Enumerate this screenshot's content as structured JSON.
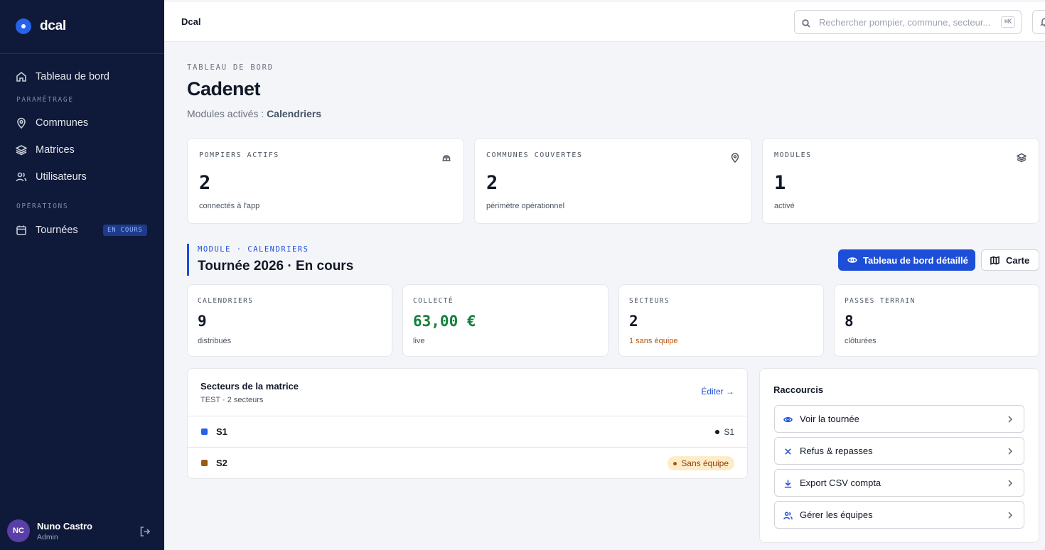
{
  "sidebar": {
    "brand": "dcal",
    "nav": {
      "dashboard": "Tableau de bord",
      "section_settings": "PARAMÉTRAGE",
      "communes": "Communes",
      "matrices": "Matrices",
      "users": "Utilisateurs",
      "section_operations": "OPÉRATIONS",
      "tours": "Tournées",
      "tours_badge": "EN COURS"
    },
    "user": {
      "initials": "NC",
      "name": "Nuno Castro",
      "role": "Admin"
    }
  },
  "topbar": {
    "title": "Dcal",
    "search_placeholder": "Rechercher pompier, commune, secteur...",
    "search_shortcut": "⌘K"
  },
  "header": {
    "eyebrow": "TABLEAU DE BORD",
    "title": "Cadenet",
    "modules_prefix": "Modules activés : ",
    "modules_value": "Calendriers"
  },
  "stats": [
    {
      "label": "POMPIERS ACTIFS",
      "value": "2",
      "sub": "connectés à l'app",
      "icon": "helmet-icon"
    },
    {
      "label": "COMMUNES COUVERTES",
      "value": "2",
      "sub": "périmètre opérationnel",
      "icon": "map-pin-icon"
    },
    {
      "label": "MODULES",
      "value": "1",
      "sub": "activé",
      "icon": "layers-icon"
    }
  ],
  "module": {
    "eyebrow": "MODULE · CALENDRIERS",
    "title": "Tournée 2026 · En cours",
    "primary_button": "Tableau de bord détaillé",
    "secondary_button": "Carte"
  },
  "metrics": [
    {
      "label": "CALENDRIERS",
      "value": "9",
      "sub": "distribués"
    },
    {
      "label": "COLLECTÉ",
      "value": "63,00 €",
      "sub": "live"
    },
    {
      "label": "SECTEURS",
      "value": "2",
      "sub": "1 sans équipe"
    },
    {
      "label": "PASSES TERRAIN",
      "value": "8",
      "sub": "clôturées"
    }
  ],
  "sectors": {
    "title": "Secteurs de la matrice",
    "subtitle": "TEST · 2 secteurs",
    "edit_label": "Éditer →",
    "rows": [
      {
        "name": "S1",
        "color": "#2563eb",
        "team": "S1"
      },
      {
        "name": "S2",
        "color": "#9a5b17",
        "pill": "Sans équipe"
      }
    ]
  },
  "shortcuts": {
    "title": "Raccourcis",
    "items": [
      {
        "label": "Voir la tournée",
        "icon": "eye-icon"
      },
      {
        "label": "Refus & repasses",
        "icon": "x-icon"
      },
      {
        "label": "Export CSV compta",
        "icon": "download-icon"
      },
      {
        "label": "Gérer les équipes",
        "icon": "users-icon"
      }
    ]
  },
  "colors": {
    "sidebar_bg": "#0f1a3a",
    "accent": "#1d4ed8",
    "collected": "#15803d",
    "warning": "#b45309"
  }
}
